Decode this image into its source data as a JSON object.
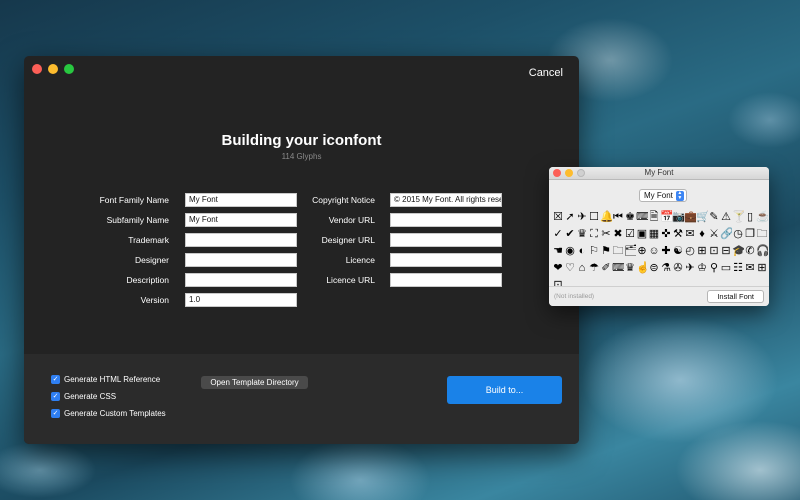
{
  "main_window": {
    "cancel_label": "Cancel",
    "title": "Building your iconfont",
    "subtitle": "114 Glyphs",
    "left_fields": [
      {
        "label": "Font Family Name",
        "value": "My Font"
      },
      {
        "label": "Subfamily Name",
        "value": "My Font"
      },
      {
        "label": "Trademark",
        "value": ""
      },
      {
        "label": "Designer",
        "value": ""
      },
      {
        "label": "Description",
        "value": ""
      },
      {
        "label": "Version",
        "value": "1.0"
      }
    ],
    "right_fields": [
      {
        "label": "Copyright Notice",
        "value": "© 2015 My Font. All rights rese"
      },
      {
        "label": "Vendor URL",
        "value": ""
      },
      {
        "label": "Designer URL",
        "value": ""
      },
      {
        "label": "Licence",
        "value": ""
      },
      {
        "label": "Licence URL",
        "value": ""
      }
    ],
    "options": [
      {
        "label": "Generate HTML Reference",
        "checked": true
      },
      {
        "label": "Generate CSS",
        "checked": true
      },
      {
        "label": "Generate Custom Templates",
        "checked": true
      }
    ],
    "template_button_label": "Open Template Directory",
    "build_button_label": "Build to..."
  },
  "font_window": {
    "title": "My Font",
    "selected_font": "My Font",
    "glyphs": [
      "☒",
      "➚",
      "✈",
      "☐",
      "🔔",
      "⏮",
      "♚",
      "⌨",
      "🗎",
      "📅",
      "📷",
      "💼",
      "🛒",
      "✎",
      "⚠",
      "🍸",
      "▯",
      "☕",
      "✓",
      "✔",
      "♛",
      "⛶",
      "✂",
      "✖",
      "☑",
      "▣",
      "▦",
      "✜",
      "⚒",
      "✉",
      "♦",
      "⚔",
      "🔗",
      "◷",
      "❐",
      "🗀",
      "☚",
      "◉",
      "◐",
      "⚐",
      "⚑",
      "🗀",
      "🗂",
      "⊕",
      "☺",
      "✚",
      "☯",
      "◴",
      "⊞",
      "⊡",
      "⊟",
      "🎓",
      "✆",
      "🎧",
      "❤",
      "♡",
      "⌂",
      "☂",
      "✐",
      "⌨",
      "♛",
      "☝",
      "⊜",
      "⚗",
      "✇",
      "✈",
      "♔",
      "⚲",
      "▭",
      "☷",
      "✉",
      "⊞",
      "⊡"
    ],
    "status": "(Not installed)",
    "install_label": "Install Font"
  }
}
